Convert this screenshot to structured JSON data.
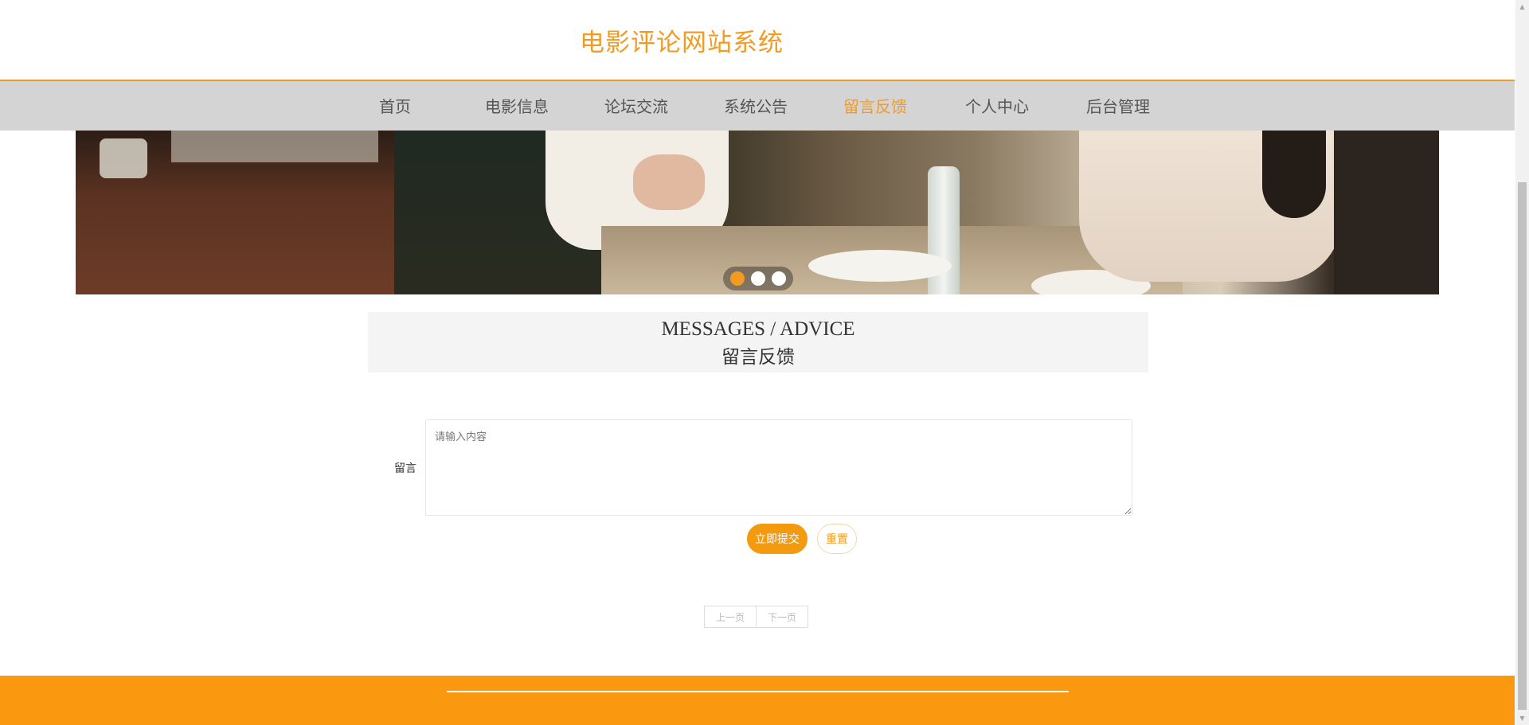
{
  "header": {
    "site_title": "电影评论网站系统"
  },
  "nav": {
    "items": [
      {
        "label": "首页"
      },
      {
        "label": "电影信息"
      },
      {
        "label": "论坛交流"
      },
      {
        "label": "系统公告"
      },
      {
        "label": "留言反馈"
      },
      {
        "label": "个人中心"
      },
      {
        "label": "后台管理"
      }
    ],
    "active_index": 4
  },
  "banner": {
    "slide_count": 3,
    "active_slide": 1
  },
  "section": {
    "title_en": "MESSAGES / ADVICE",
    "title_cn": "留言反馈"
  },
  "form": {
    "message_label": "留言",
    "message_value": "",
    "message_placeholder": "请输入内容",
    "submit_label": "立即提交",
    "reset_label": "重置"
  },
  "pager": {
    "prev_label": "上一页",
    "next_label": "下一页"
  },
  "colors": {
    "accent": "#f39a23",
    "footer": "#fa990f",
    "nav_bg": "#d4d4d4"
  }
}
